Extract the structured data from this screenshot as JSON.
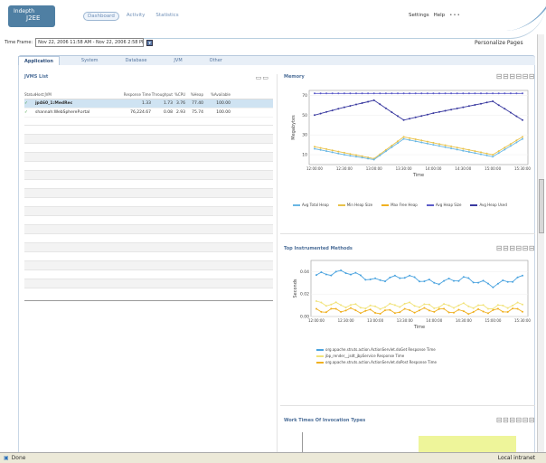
{
  "app": {
    "logo_line1": "Indepth",
    "logo_line2": "J2EE"
  },
  "nav": {
    "items": [
      "Dashboard",
      "Activity",
      "Statistics"
    ]
  },
  "header": {
    "settings": "Settings",
    "help": "Help",
    "dots": "•••"
  },
  "timeframe": {
    "label": "Time Frame:",
    "value": "Nov 22, 2006 11:58 AM - Nov 22, 2006 2:58 PM"
  },
  "personalize": "Personalize Pages",
  "tabs": [
    "Application",
    "System",
    "Database",
    "JVM",
    "Other"
  ],
  "jvm_list": {
    "title": "JVMS List",
    "columns": [
      "Status",
      "Host:JVM",
      "Response Time",
      "Throughput",
      "%CPU",
      "%Heap",
      "%Available"
    ],
    "rows": [
      [
        "✓",
        "jp460_1:MedRec",
        "1.33",
        "1.73",
        "3.76",
        "77.40",
        "100.00"
      ],
      [
        "✓",
        "shannah:WebSphereP.ortal",
        "76,224.67",
        "0.08",
        "2.93",
        "75.74",
        "100.00"
      ]
    ]
  },
  "memory": {
    "title": "Memory",
    "ylabel": "Megabytes",
    "xlabel": "Time",
    "legend": [
      "Avg Total Heap",
      "Min Heap Size",
      "Max Free Heap",
      "Avg Heap Size",
      "Avg Heap Used"
    ]
  },
  "methods": {
    "title": "Top Instrumented Methods",
    "ylabel": "Seconds",
    "xlabel": "Time",
    "legend": [
      "org.apache.struts.action.ActionServlet.doGet Response Time",
      "jbp_render__jsdt_jbpService Response Time",
      "org.apache.struts.action.ActionServlet.doPost Response Time"
    ]
  },
  "work": {
    "title": "Work Times Of Invocation Types"
  },
  "xticks": [
    "12:00:00",
    "12:30:00",
    "13:00:00",
    "13:30:00",
    "14:00:00",
    "14:30:00",
    "15:00:00",
    "15:30:00"
  ],
  "mem_yticks": [
    "70",
    "50",
    "30",
    "10"
  ],
  "meth_yticks": [
    "0.04",
    "0.02",
    "0.00"
  ],
  "status": {
    "left": "Done",
    "right": "Local intranet"
  },
  "colors": {
    "accent": "#4f7fa3",
    "selected_row": "#cfe3f2"
  },
  "chart_data": [
    {
      "type": "line",
      "title": "Memory",
      "xlabel": "Time",
      "ylabel": "Megabytes",
      "ylim": [
        0,
        75
      ],
      "x": [
        "12:00:00",
        "12:30:00",
        "13:00:00",
        "13:30:00",
        "14:00:00",
        "14:30:00",
        "15:00:00",
        "15:30:00"
      ],
      "series": [
        {
          "name": "Avg Total Heap",
          "values": [
            72,
            72,
            72,
            72,
            72,
            72,
            72,
            72
          ]
        },
        {
          "name": "Avg Heap Used",
          "values": [
            50,
            58,
            65,
            45,
            52,
            58,
            64,
            45
          ]
        },
        {
          "name": "Max Free Heap",
          "values": [
            18,
            12,
            6,
            28,
            22,
            16,
            10,
            28
          ]
        },
        {
          "name": "Min Heap Size",
          "values": [
            16,
            10,
            5,
            26,
            20,
            14,
            8,
            26
          ]
        }
      ]
    },
    {
      "type": "line",
      "title": "Top Instrumented Methods",
      "xlabel": "Time",
      "ylabel": "Seconds",
      "ylim": [
        0,
        0.05
      ],
      "x": [
        "12:00:00",
        "12:30:00",
        "13:00:00",
        "13:30:00",
        "14:00:00",
        "14:30:00",
        "15:00:00",
        "15:30:00"
      ],
      "series": [
        {
          "name": "org.apache.struts.action.ActionServlet.doGet Response Time",
          "values": [
            0.037,
            0.04,
            0.032,
            0.036,
            0.03,
            0.034,
            0.028,
            0.035
          ]
        },
        {
          "name": "jbp_render__jsdt_jbpService Response Time",
          "values": [
            0.012,
            0.01,
            0.008,
            0.011,
            0.009,
            0.01,
            0.008,
            0.011
          ]
        },
        {
          "name": "org.apache.struts.action.ActionServlet.doPost Response Time",
          "values": [
            0.005,
            0.006,
            0.004,
            0.005,
            0.006,
            0.004,
            0.005,
            0.006
          ]
        }
      ]
    }
  ]
}
